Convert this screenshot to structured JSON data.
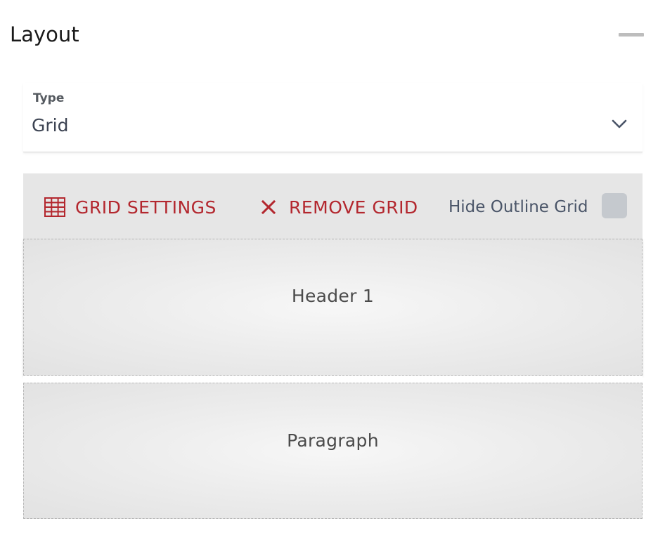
{
  "panel": {
    "title": "Layout"
  },
  "type_select": {
    "label": "Type",
    "value": "Grid"
  },
  "toolbar": {
    "grid_settings_label": "GRID SETTINGS",
    "remove_grid_label": "REMOVE GRID",
    "hide_outline_label": "Hide Outline Grid",
    "hide_outline_checked": false
  },
  "cells": [
    {
      "label": "Header 1"
    },
    {
      "label": "Paragraph"
    }
  ],
  "colors": {
    "accent": "#b3272e",
    "toolbar_bg": "#e6e6e6",
    "checkbox_bg": "#c5c9ce"
  },
  "icons": {
    "grid_settings": "grid-icon",
    "remove_grid": "close-icon",
    "collapse": "minus-icon",
    "select_open": "chevron-down-icon"
  }
}
